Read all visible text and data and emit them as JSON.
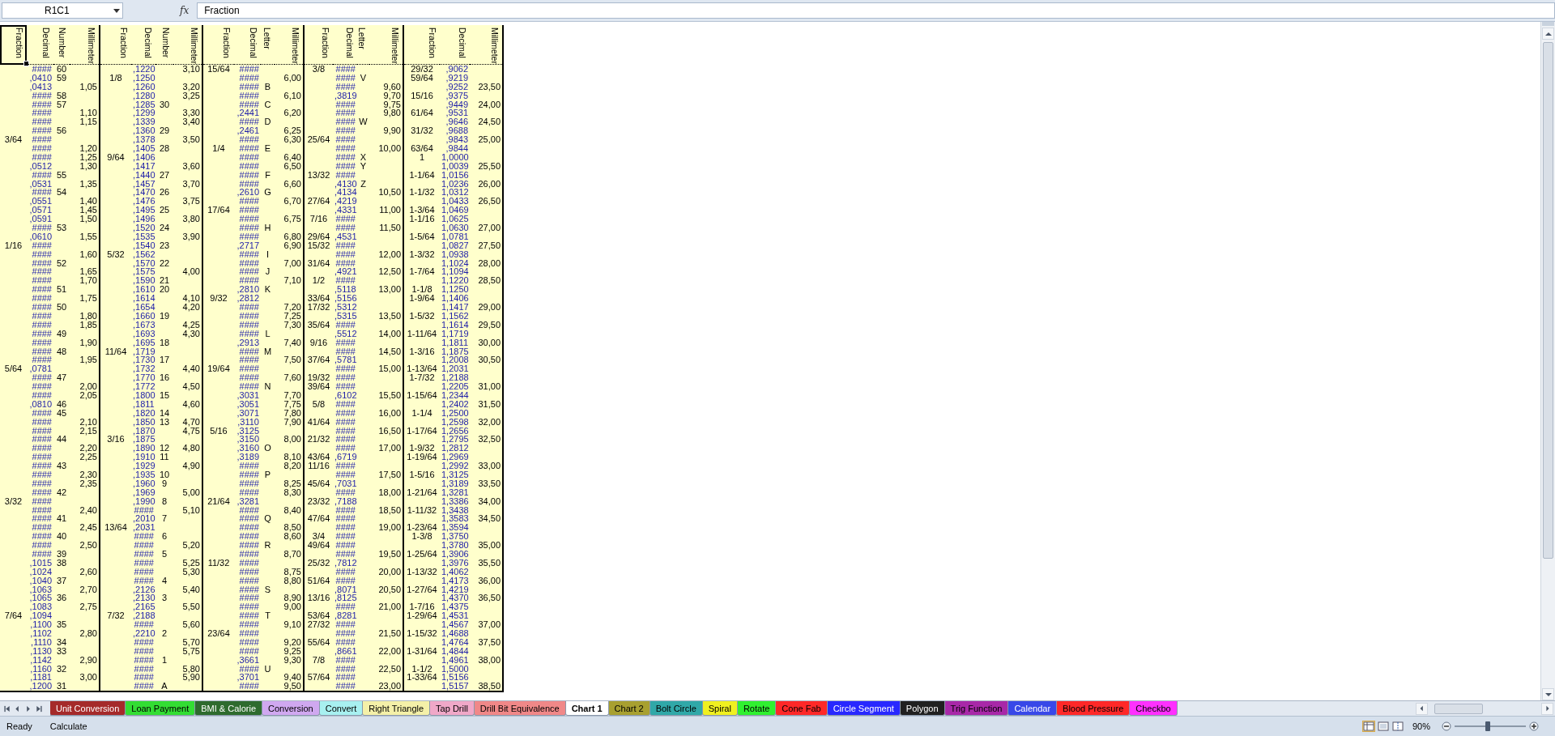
{
  "formula_bar": {
    "name_box": "R1C1",
    "function_button": "fx",
    "formula": "Fraction"
  },
  "blocks": [
    {
      "columns": [
        {
          "kind": "fraction",
          "label": "Fraction",
          "selected": true
        },
        {
          "kind": "decimal",
          "label": "Decimal",
          "selected": false
        },
        {
          "kind": "number",
          "label": "Number",
          "selected": false
        },
        {
          "kind": "millimeter",
          "label": "Millimeter",
          "selected": false
        }
      ],
      "rows": [
        {
          "decimal": "####",
          "number": "60"
        },
        {
          "decimal": ",0410",
          "number": "59"
        },
        {
          "decimal": ",0413",
          "millimeter": "1,05"
        },
        {
          "decimal": "####",
          "number": "58"
        },
        {
          "decimal": "####",
          "number": "57"
        },
        {
          "decimal": "####",
          "millimeter": "1,10"
        },
        {
          "decimal": "####",
          "millimeter": "1,15"
        },
        {
          "decimal": "####",
          "number": "56"
        },
        {
          "fraction": "3/64",
          "decimal": "####"
        },
        {
          "decimal": "####",
          "millimeter": "1,20"
        },
        {
          "decimal": "####",
          "millimeter": "1,25"
        },
        {
          "decimal": ",0512",
          "millimeter": "1,30"
        },
        {
          "decimal": "####",
          "number": "55"
        },
        {
          "decimal": ",0531",
          "millimeter": "1,35"
        },
        {
          "decimal": "####",
          "number": "54"
        },
        {
          "decimal": ",0551",
          "millimeter": "1,40"
        },
        {
          "decimal": ",0571",
          "millimeter": "1,45"
        },
        {
          "decimal": ",0591",
          "millimeter": "1,50"
        },
        {
          "decimal": "####",
          "number": "53"
        },
        {
          "decimal": ",0610",
          "millimeter": "1,55"
        },
        {
          "fraction": "1/16",
          "decimal": "####"
        },
        {
          "decimal": "####",
          "millimeter": "1,60"
        },
        {
          "decimal": "####",
          "number": "52"
        },
        {
          "decimal": "####",
          "millimeter": "1,65"
        },
        {
          "decimal": "####",
          "millimeter": "1,70"
        },
        {
          "decimal": "####",
          "number": "51"
        },
        {
          "decimal": "####",
          "millimeter": "1,75"
        },
        {
          "decimal": "####",
          "number": "50"
        },
        {
          "decimal": "####",
          "millimeter": "1,80"
        },
        {
          "decimal": "####",
          "millimeter": "1,85"
        },
        {
          "decimal": "####",
          "number": "49"
        },
        {
          "decimal": "####",
          "millimeter": "1,90"
        },
        {
          "decimal": "####",
          "number": "48"
        },
        {
          "decimal": "####",
          "millimeter": "1,95"
        },
        {
          "fraction": "5/64",
          "decimal": ",0781"
        },
        {
          "decimal": "####",
          "number": "47"
        },
        {
          "decimal": "####",
          "millimeter": "2,00"
        },
        {
          "decimal": "####",
          "millimeter": "2,05"
        },
        {
          "decimal": ",0810",
          "number": "46"
        },
        {
          "decimal": "####",
          "number": "45"
        },
        {
          "decimal": "####",
          "millimeter": "2,10"
        },
        {
          "decimal": "####",
          "millimeter": "2,15"
        },
        {
          "decimal": "####",
          "number": "44"
        },
        {
          "decimal": "####",
          "millimeter": "2,20"
        },
        {
          "decimal": "####",
          "millimeter": "2,25"
        },
        {
          "decimal": "####",
          "number": "43"
        },
        {
          "decimal": "####",
          "millimeter": "2,30"
        },
        {
          "decimal": "####",
          "millimeter": "2,35"
        },
        {
          "decimal": "####",
          "number": "42"
        },
        {
          "fraction": "3/32",
          "decimal": "####"
        },
        {
          "decimal": "####",
          "millimeter": "2,40"
        },
        {
          "decimal": "####",
          "number": "41"
        },
        {
          "decimal": "####",
          "millimeter": "2,45"
        },
        {
          "decimal": "####",
          "number": "40"
        },
        {
          "decimal": "####",
          "millimeter": "2,50"
        },
        {
          "decimal": "####",
          "number": "39"
        },
        {
          "decimal": ",1015",
          "number": "38"
        },
        {
          "decimal": ",1024",
          "millimeter": "2,60"
        },
        {
          "decimal": ",1040",
          "number": "37"
        },
        {
          "decimal": ",1063",
          "millimeter": "2,70"
        },
        {
          "decimal": ",1065",
          "number": "36"
        },
        {
          "decimal": ",1083",
          "millimeter": "2,75"
        },
        {
          "fraction": "7/64",
          "decimal": ",1094"
        },
        {
          "decimal": ",1100",
          "number": "35"
        },
        {
          "decimal": ",1102",
          "millimeter": "2,80"
        },
        {
          "decimal": ",1110",
          "number": "34"
        },
        {
          "decimal": ",1130",
          "number": "33"
        },
        {
          "decimal": ",1142",
          "millimeter": "2,90"
        },
        {
          "decimal": ",1160",
          "number": "32"
        },
        {
          "decimal": ",1181",
          "millimeter": "3,00"
        },
        {
          "decimal": ",1200",
          "number": "31"
        }
      ]
    },
    {
      "columns": [
        {
          "kind": "fraction",
          "label": "Fraction",
          "selected": false
        },
        {
          "kind": "decimal",
          "label": "Decimal",
          "selected": false
        },
        {
          "kind": "number",
          "label": "Number",
          "selected": false
        },
        {
          "kind": "millimeter",
          "label": "Millimeter",
          "selected": false
        }
      ],
      "rows": [
        {
          "decimal": ",1220",
          "millimeter": "3,10"
        },
        {
          "fraction": "1/8",
          "decimal": ",1250"
        },
        {
          "decimal": ",1260",
          "millimeter": "3,20"
        },
        {
          "decimal": ",1280",
          "millimeter": "3,25"
        },
        {
          "decimal": ",1285",
          "number": "30"
        },
        {
          "decimal": ",1299",
          "millimeter": "3,30"
        },
        {
          "decimal": ",1339",
          "millimeter": "3,40"
        },
        {
          "decimal": ",1360",
          "number": "29"
        },
        {
          "decimal": ",1378",
          "millimeter": "3,50"
        },
        {
          "decimal": ",1405",
          "number": "28"
        },
        {
          "fraction": "9/64",
          "decimal": ",1406"
        },
        {
          "decimal": ",1417",
          "millimeter": "3,60"
        },
        {
          "decimal": ",1440",
          "number": "27"
        },
        {
          "decimal": ",1457",
          "millimeter": "3,70"
        },
        {
          "decimal": ",1470",
          "number": "26"
        },
        {
          "decimal": ",1476",
          "millimeter": "3,75"
        },
        {
          "decimal": ",1495",
          "number": "25"
        },
        {
          "decimal": ",1496",
          "millimeter": "3,80"
        },
        {
          "decimal": ",1520",
          "number": "24"
        },
        {
          "decimal": ",1535",
          "millimeter": "3,90"
        },
        {
          "decimal": ",1540",
          "number": "23"
        },
        {
          "fraction": "5/32",
          "decimal": ",1562"
        },
        {
          "decimal": ",1570",
          "number": "22"
        },
        {
          "decimal": ",1575",
          "millimeter": "4,00"
        },
        {
          "decimal": ",1590",
          "number": "21"
        },
        {
          "decimal": ",1610",
          "number": "20"
        },
        {
          "decimal": ",1614",
          "millimeter": "4,10"
        },
        {
          "decimal": ",1654",
          "millimeter": "4,20"
        },
        {
          "decimal": ",1660",
          "number": "19"
        },
        {
          "decimal": ",1673",
          "millimeter": "4,25"
        },
        {
          "decimal": ",1693",
          "millimeter": "4,30"
        },
        {
          "decimal": ",1695",
          "number": "18"
        },
        {
          "fraction": "11/64",
          "decimal": ",1719"
        },
        {
          "decimal": ",1730",
          "number": "17"
        },
        {
          "decimal": ",1732",
          "millimeter": "4,40"
        },
        {
          "decimal": ",1770",
          "number": "16"
        },
        {
          "decimal": ",1772",
          "millimeter": "4,50"
        },
        {
          "decimal": ",1800",
          "number": "15"
        },
        {
          "decimal": ",1811",
          "millimeter": "4,60"
        },
        {
          "decimal": ",1820",
          "number": "14"
        },
        {
          "decimal": ",1850",
          "number": "13",
          "millimeter": "4,70"
        },
        {
          "decimal": ",1870",
          "millimeter": "4,75"
        },
        {
          "fraction": "3/16",
          "decimal": ",1875"
        },
        {
          "decimal": ",1890",
          "number": "12",
          "millimeter": "4,80"
        },
        {
          "decimal": ",1910",
          "number": "11"
        },
        {
          "decimal": ",1929",
          "millimeter": "4,90"
        },
        {
          "decimal": ",1935",
          "number": "10"
        },
        {
          "decimal": ",1960",
          "number": "9"
        },
        {
          "decimal": ",1969",
          "millimeter": "5,00"
        },
        {
          "decimal": ",1990",
          "number": "8"
        },
        {
          "decimal": "####",
          "millimeter": "5,10"
        },
        {
          "decimal": ",2010",
          "number": "7"
        },
        {
          "fraction": "13/64",
          "decimal": ",2031"
        },
        {
          "decimal": "####",
          "number": "6"
        },
        {
          "decimal": "####",
          "millimeter": "5,20"
        },
        {
          "decimal": "####",
          "number": "5"
        },
        {
          "decimal": "####",
          "millimeter": "5,25"
        },
        {
          "decimal": "####",
          "millimeter": "5,30"
        },
        {
          "decimal": "####",
          "number": "4"
        },
        {
          "decimal": ",2126",
          "millimeter": "5,40"
        },
        {
          "decimal": ",2130",
          "number": "3"
        },
        {
          "decimal": ",2165",
          "millimeter": "5,50"
        },
        {
          "fraction": "7/32",
          "decimal": ",2188"
        },
        {
          "decimal": "####",
          "millimeter": "5,60"
        },
        {
          "decimal": ",2210",
          "number": "2"
        },
        {
          "decimal": "####",
          "millimeter": "5,70"
        },
        {
          "decimal": "####",
          "millimeter": "5,75"
        },
        {
          "decimal": "####",
          "number": "1"
        },
        {
          "decimal": "####",
          "millimeter": "5,80"
        },
        {
          "decimal": "####",
          "millimeter": "5,90"
        },
        {
          "decimal": "####",
          "number": "A"
        }
      ]
    },
    {
      "columns": [
        {
          "kind": "fraction",
          "label": "Fraction",
          "selected": false
        },
        {
          "kind": "decimal",
          "label": "Decimal",
          "selected": false
        },
        {
          "kind": "letter",
          "label": "Letter",
          "selected": false
        },
        {
          "kind": "millimeter",
          "label": "Millimeter",
          "selected": false
        }
      ],
      "rows": [
        {
          "fraction": "15/64",
          "decimal": "####"
        },
        {
          "decimal": "####",
          "millimeter": "6,00"
        },
        {
          "decimal": "####",
          "letter": "B"
        },
        {
          "decimal": "####",
          "millimeter": "6,10"
        },
        {
          "decimal": "####",
          "letter": "C"
        },
        {
          "decimal": ",2441",
          "millimeter": "6,20"
        },
        {
          "decimal": "####",
          "letter": "D"
        },
        {
          "decimal": ",2461",
          "millimeter": "6,25"
        },
        {
          "decimal": "####",
          "millimeter": "6,30"
        },
        {
          "fraction": "1/4",
          "decimal": "####",
          "letter": "E"
        },
        {
          "decimal": "####",
          "millimeter": "6,40"
        },
        {
          "decimal": "####",
          "millimeter": "6,50"
        },
        {
          "decimal": "####",
          "letter": "F"
        },
        {
          "decimal": "####",
          "millimeter": "6,60"
        },
        {
          "decimal": ",2610",
          "letter": "G"
        },
        {
          "decimal": "####",
          "millimeter": "6,70"
        },
        {
          "fraction": "17/64",
          "decimal": "####"
        },
        {
          "decimal": "####",
          "millimeter": "6,75"
        },
        {
          "decimal": "####",
          "letter": "H"
        },
        {
          "decimal": "####",
          "millimeter": "6,80"
        },
        {
          "decimal": ",2717",
          "millimeter": "6,90"
        },
        {
          "decimal": "####",
          "letter": "I"
        },
        {
          "decimal": "####",
          "millimeter": "7,00"
        },
        {
          "decimal": "####",
          "letter": "J"
        },
        {
          "decimal": "####",
          "millimeter": "7,10"
        },
        {
          "decimal": ",2810",
          "letter": "K"
        },
        {
          "fraction": "9/32",
          "decimal": ",2812"
        },
        {
          "decimal": "####",
          "millimeter": "7,20"
        },
        {
          "decimal": "####",
          "millimeter": "7,25"
        },
        {
          "decimal": "####",
          "millimeter": "7,30"
        },
        {
          "decimal": "####",
          "letter": "L"
        },
        {
          "decimal": ",2913",
          "millimeter": "7,40"
        },
        {
          "decimal": "####",
          "letter": "M"
        },
        {
          "decimal": "####",
          "millimeter": "7,50"
        },
        {
          "fraction": "19/64",
          "decimal": "####"
        },
        {
          "decimal": "####",
          "millimeter": "7,60"
        },
        {
          "decimal": "####",
          "letter": "N"
        },
        {
          "decimal": ",3031",
          "millimeter": "7,70"
        },
        {
          "decimal": ",3051",
          "millimeter": "7,75"
        },
        {
          "decimal": ",3071",
          "millimeter": "7,80"
        },
        {
          "decimal": ",3110",
          "millimeter": "7,90"
        },
        {
          "fraction": "5/16",
          "decimal": ",3125"
        },
        {
          "decimal": ",3150",
          "millimeter": "8,00"
        },
        {
          "decimal": ",3160",
          "letter": "O"
        },
        {
          "decimal": ",3189",
          "millimeter": "8,10"
        },
        {
          "decimal": "####",
          "millimeter": "8,20"
        },
        {
          "decimal": "####",
          "letter": "P"
        },
        {
          "decimal": "####",
          "millimeter": "8,25"
        },
        {
          "decimal": "####",
          "millimeter": "8,30"
        },
        {
          "fraction": "21/64",
          "decimal": ",3281"
        },
        {
          "decimal": "####",
          "millimeter": "8,40"
        },
        {
          "decimal": "####",
          "letter": "Q"
        },
        {
          "decimal": "####",
          "millimeter": "8,50"
        },
        {
          "decimal": "####",
          "millimeter": "8,60"
        },
        {
          "decimal": "####",
          "letter": "R"
        },
        {
          "decimal": "####",
          "millimeter": "8,70"
        },
        {
          "fraction": "11/32",
          "decimal": "####"
        },
        {
          "decimal": "####",
          "millimeter": "8,75"
        },
        {
          "decimal": "####",
          "millimeter": "8,80"
        },
        {
          "decimal": "####",
          "letter": "S"
        },
        {
          "decimal": "####",
          "millimeter": "8,90"
        },
        {
          "decimal": "####",
          "millimeter": "9,00"
        },
        {
          "decimal": "####",
          "letter": "T"
        },
        {
          "decimal": "####",
          "millimeter": "9,10"
        },
        {
          "fraction": "23/64",
          "decimal": "####"
        },
        {
          "decimal": "####",
          "millimeter": "9,20"
        },
        {
          "decimal": "####",
          "millimeter": "9,25"
        },
        {
          "decimal": ",3661",
          "millimeter": "9,30"
        },
        {
          "decimal": "####",
          "letter": "U"
        },
        {
          "decimal": ",3701",
          "millimeter": "9,40"
        },
        {
          "decimal": "####",
          "millimeter": "9,50"
        }
      ]
    },
    {
      "columns": [
        {
          "kind": "fraction",
          "label": "Fraction",
          "selected": false
        },
        {
          "kind": "decimal",
          "label": "Decimal",
          "selected": false
        },
        {
          "kind": "letter",
          "label": "Letter",
          "selected": false
        },
        {
          "kind": "millimeter",
          "label": "Millimeter",
          "selected": false
        }
      ],
      "rows": [
        {
          "fraction": "3/8",
          "decimal": "####"
        },
        {
          "decimal": "####",
          "letter": "V"
        },
        {
          "decimal": "####",
          "millimeter": "9,60"
        },
        {
          "decimal": ",3819",
          "millimeter": "9,70"
        },
        {
          "decimal": "####",
          "millimeter": "9,75"
        },
        {
          "decimal": "####",
          "millimeter": "9,80"
        },
        {
          "decimal": "####",
          "letter": "W"
        },
        {
          "decimal": "####",
          "millimeter": "9,90"
        },
        {
          "fraction": "25/64",
          "decimal": "####"
        },
        {
          "decimal": "####",
          "millimeter": "10,00"
        },
        {
          "decimal": "####",
          "letter": "X"
        },
        {
          "decimal": "####",
          "letter": "Y"
        },
        {
          "fraction": "13/32",
          "decimal": "####"
        },
        {
          "decimal": ",4130",
          "letter": "Z"
        },
        {
          "decimal": ",4134",
          "millimeter": "10,50"
        },
        {
          "fraction": "27/64",
          "decimal": ",4219"
        },
        {
          "decimal": ",4331",
          "millimeter": "11,00"
        },
        {
          "fraction": "7/16",
          "decimal": "####"
        },
        {
          "decimal": "####",
          "millimeter": "11,50"
        },
        {
          "fraction": "29/64",
          "decimal": ",4531"
        },
        {
          "fraction": "15/32",
          "decimal": "####"
        },
        {
          "decimal": "####",
          "millimeter": "12,00"
        },
        {
          "fraction": "31/64",
          "decimal": "####"
        },
        {
          "decimal": ",4921",
          "millimeter": "12,50"
        },
        {
          "fraction": "1/2",
          "decimal": "####"
        },
        {
          "decimal": ",5118",
          "millimeter": "13,00"
        },
        {
          "fraction": "33/64",
          "decimal": ",5156"
        },
        {
          "fraction": "17/32",
          "decimal": ",5312"
        },
        {
          "decimal": ",5315",
          "millimeter": "13,50"
        },
        {
          "fraction": "35/64",
          "decimal": "####"
        },
        {
          "decimal": ",5512",
          "millimeter": "14,00"
        },
        {
          "fraction": "9/16",
          "decimal": "####"
        },
        {
          "decimal": "####",
          "millimeter": "14,50"
        },
        {
          "fraction": "37/64",
          "decimal": ",5781"
        },
        {
          "decimal": "####",
          "millimeter": "15,00"
        },
        {
          "fraction": "19/32",
          "decimal": "####"
        },
        {
          "fraction": "39/64",
          "decimal": "####"
        },
        {
          "decimal": ",6102",
          "millimeter": "15,50"
        },
        {
          "fraction": "5/8",
          "decimal": "####"
        },
        {
          "decimal": "####",
          "millimeter": "16,00"
        },
        {
          "fraction": "41/64",
          "decimal": "####"
        },
        {
          "decimal": "####",
          "millimeter": "16,50"
        },
        {
          "fraction": "21/32",
          "decimal": "####"
        },
        {
          "decimal": "####",
          "millimeter": "17,00"
        },
        {
          "fraction": "43/64",
          "decimal": ",6719"
        },
        {
          "fraction": "11/16",
          "decimal": "####"
        },
        {
          "decimal": "####",
          "millimeter": "17,50"
        },
        {
          "fraction": "45/64",
          "decimal": ",7031"
        },
        {
          "decimal": "####",
          "millimeter": "18,00"
        },
        {
          "fraction": "23/32",
          "decimal": ",7188"
        },
        {
          "decimal": "####",
          "millimeter": "18,50"
        },
        {
          "fraction": "47/64",
          "decimal": "####"
        },
        {
          "decimal": "####",
          "millimeter": "19,00"
        },
        {
          "fraction": "3/4",
          "decimal": "####"
        },
        {
          "fraction": "49/64",
          "decimal": "####"
        },
        {
          "decimal": "####",
          "millimeter": "19,50"
        },
        {
          "fraction": "25/32",
          "decimal": ",7812"
        },
        {
          "decimal": "####",
          "millimeter": "20,00"
        },
        {
          "fraction": "51/64",
          "decimal": "####"
        },
        {
          "decimal": ",8071",
          "millimeter": "20,50"
        },
        {
          "fraction": "13/16",
          "decimal": ",8125"
        },
        {
          "decimal": "####",
          "millimeter": "21,00"
        },
        {
          "fraction": "53/64",
          "decimal": ",8281"
        },
        {
          "fraction": "27/32",
          "decimal": "####"
        },
        {
          "decimal": "####",
          "millimeter": "21,50"
        },
        {
          "fraction": "55/64",
          "decimal": "####"
        },
        {
          "decimal": ",8661",
          "millimeter": "22,00"
        },
        {
          "fraction": "7/8",
          "decimal": "####"
        },
        {
          "decimal": "####",
          "millimeter": "22,50"
        },
        {
          "fraction": "57/64",
          "decimal": "####"
        },
        {
          "decimal": "####",
          "millimeter": "23,00"
        }
      ]
    },
    {
      "columns": [
        {
          "kind": "fraction",
          "label": "Fraction",
          "selected": false
        },
        {
          "kind": "decimal",
          "label": "Decimal",
          "selected": false
        },
        {
          "kind": "millimeter",
          "label": "Millimeter",
          "selected": false
        }
      ],
      "rows": [
        {
          "fraction": "29/32",
          "decimal": ",9062"
        },
        {
          "fraction": "59/64",
          "decimal": ",9219"
        },
        {
          "decimal": ",9252",
          "millimeter": "23,50"
        },
        {
          "fraction": "15/16",
          "decimal": ",9375"
        },
        {
          "decimal": ",9449",
          "millimeter": "24,00"
        },
        {
          "fraction": "61/64",
          "decimal": ",9531"
        },
        {
          "decimal": ",9646",
          "millimeter": "24,50"
        },
        {
          "fraction": "31/32",
          "decimal": ",9688"
        },
        {
          "decimal": ",9843",
          "millimeter": "25,00"
        },
        {
          "fraction": "63/64",
          "decimal": ",9844"
        },
        {
          "fraction": "1",
          "decimal": "1,0000"
        },
        {
          "decimal": "1,0039",
          "millimeter": "25,50"
        },
        {
          "fraction": "1-1/64",
          "decimal": "1,0156"
        },
        {
          "decimal": "1,0236",
          "millimeter": "26,00"
        },
        {
          "fraction": "1-1/32",
          "decimal": "1,0312"
        },
        {
          "decimal": "1,0433",
          "millimeter": "26,50"
        },
        {
          "fraction": "1-3/64",
          "decimal": "1,0469"
        },
        {
          "fraction": "1-1/16",
          "decimal": "1,0625"
        },
        {
          "decimal": "1,0630",
          "millimeter": "27,00"
        },
        {
          "fraction": "1-5/64",
          "decimal": "1,0781"
        },
        {
          "decimal": "1,0827",
          "millimeter": "27,50"
        },
        {
          "fraction": "1-3/32",
          "decimal": "1,0938"
        },
        {
          "decimal": "1,1024",
          "millimeter": "28,00"
        },
        {
          "fraction": "1-7/64",
          "decimal": "1,1094"
        },
        {
          "decimal": "1,1220",
          "millimeter": "28,50"
        },
        {
          "fraction": "1-1/8",
          "decimal": "1,1250"
        },
        {
          "fraction": "1-9/64",
          "decimal": "1,1406"
        },
        {
          "decimal": "1,1417",
          "millimeter": "29,00"
        },
        {
          "fraction": "1-5/32",
          "decimal": "1,1562"
        },
        {
          "decimal": "1,1614",
          "millimeter": "29,50"
        },
        {
          "fraction": "1-11/64",
          "decimal": "1,1719"
        },
        {
          "decimal": "1,1811",
          "millimeter": "30,00"
        },
        {
          "fraction": "1-3/16",
          "decimal": "1,1875"
        },
        {
          "decimal": "1,2008",
          "millimeter": "30,50"
        },
        {
          "fraction": "1-13/64",
          "decimal": "1,2031"
        },
        {
          "fraction": "1-7/32",
          "decimal": "1,2188"
        },
        {
          "decimal": "1,2205",
          "millimeter": "31,00"
        },
        {
          "fraction": "1-15/64",
          "decimal": "1,2344"
        },
        {
          "decimal": "1,2402",
          "millimeter": "31,50"
        },
        {
          "fraction": "1-1/4",
          "decimal": "1,2500"
        },
        {
          "decimal": "1,2598",
          "millimeter": "32,00"
        },
        {
          "fraction": "1-17/64",
          "decimal": "1,2656"
        },
        {
          "decimal": "1,2795",
          "millimeter": "32,50"
        },
        {
          "fraction": "1-9/32",
          "decimal": "1,2812"
        },
        {
          "fraction": "1-19/64",
          "decimal": "1,2969"
        },
        {
          "decimal": "1,2992",
          "millimeter": "33,00"
        },
        {
          "fraction": "1-5/16",
          "decimal": "1,3125"
        },
        {
          "decimal": "1,3189",
          "millimeter": "33,50"
        },
        {
          "fraction": "1-21/64",
          "decimal": "1,3281"
        },
        {
          "decimal": "1,3386",
          "millimeter": "34,00"
        },
        {
          "fraction": "1-11/32",
          "decimal": "1,3438"
        },
        {
          "decimal": "1,3583",
          "millimeter": "34,50"
        },
        {
          "fraction": "1-23/64",
          "decimal": "1,3594"
        },
        {
          "fraction": "1-3/8",
          "decimal": "1,3750"
        },
        {
          "decimal": "1,3780",
          "millimeter": "35,00"
        },
        {
          "fraction": "1-25/64",
          "decimal": "1,3906"
        },
        {
          "decimal": "1,3976",
          "millimeter": "35,50"
        },
        {
          "fraction": "1-13/32",
          "decimal": "1,4062"
        },
        {
          "decimal": "1,4173",
          "millimeter": "36,00"
        },
        {
          "fraction": "1-27/64",
          "decimal": "1,4219"
        },
        {
          "decimal": "1,4370",
          "millimeter": "36,50"
        },
        {
          "fraction": "1-7/16",
          "decimal": "1,4375"
        },
        {
          "fraction": "1-29/64",
          "decimal": "1,4531"
        },
        {
          "decimal": "1,4567",
          "millimeter": "37,00"
        },
        {
          "fraction": "1-15/32",
          "decimal": "1,4688"
        },
        {
          "decimal": "1,4764",
          "millimeter": "37,50"
        },
        {
          "fraction": "1-31/64",
          "decimal": "1,4844"
        },
        {
          "decimal": "1,4961",
          "millimeter": "38,00"
        },
        {
          "fraction": "1-1/2",
          "decimal": "1,5000"
        },
        {
          "fraction": "1-33/64",
          "decimal": "1,5156"
        },
        {
          "decimal": "1,5157",
          "millimeter": "38,50"
        }
      ]
    }
  ],
  "sheet_tabs": [
    {
      "label": "Unit Conversion",
      "color": "#a52a2a",
      "selected": false
    },
    {
      "label": "Loan Payment",
      "color": "#33dd33",
      "selected": false
    },
    {
      "label": "BMI & Calorie",
      "color": "#2e6b2e",
      "selected": false
    },
    {
      "label": "Conversion",
      "color": "#d0a8f0",
      "selected": false
    },
    {
      "label": "Convert",
      "color": "#a8f0f0",
      "selected": false
    },
    {
      "label": "Right Triangle",
      "color": "#f4f0a8",
      "selected": false
    },
    {
      "label": "Tap Drill",
      "color": "#f0a8c8",
      "selected": false
    },
    {
      "label": "Drill Bit Equivalence",
      "color": "#f08888",
      "selected": false
    },
    {
      "label": "Chart 1",
      "color": "#ffffff",
      "selected": true
    },
    {
      "label": "Chart 2",
      "color": "#a8a030",
      "selected": false
    },
    {
      "label": "Bolt Circle",
      "color": "#30a8a8",
      "selected": false
    },
    {
      "label": "Spiral",
      "color": "#f0f020",
      "selected": false
    },
    {
      "label": "Rotate",
      "color": "#30f030",
      "selected": false
    },
    {
      "label": "Cone Fab",
      "color": "#ff2828",
      "selected": false
    },
    {
      "label": "Circle Segment",
      "color": "#2828ff",
      "selected": false
    },
    {
      "label": "Polygon",
      "color": "#202020",
      "selected": false
    },
    {
      "label": "Trig Function",
      "color": "#a828a8",
      "selected": false
    },
    {
      "label": "Calendar",
      "color": "#3848e8",
      "selected": false
    },
    {
      "label": "Blood Pressure",
      "color": "#ff2828",
      "selected": false
    },
    {
      "label": "Checkbo",
      "color": "#ff30ff",
      "selected": false
    }
  ],
  "status_bar": {
    "status": "Ready",
    "mode": "Calculate",
    "views": [
      {
        "kind": "normal",
        "selected": true
      },
      {
        "kind": "page_layout",
        "selected": false
      },
      {
        "kind": "page_break",
        "selected": false
      }
    ],
    "zoom": "90%",
    "zoom_slider": {
      "level": 0.47
    }
  }
}
